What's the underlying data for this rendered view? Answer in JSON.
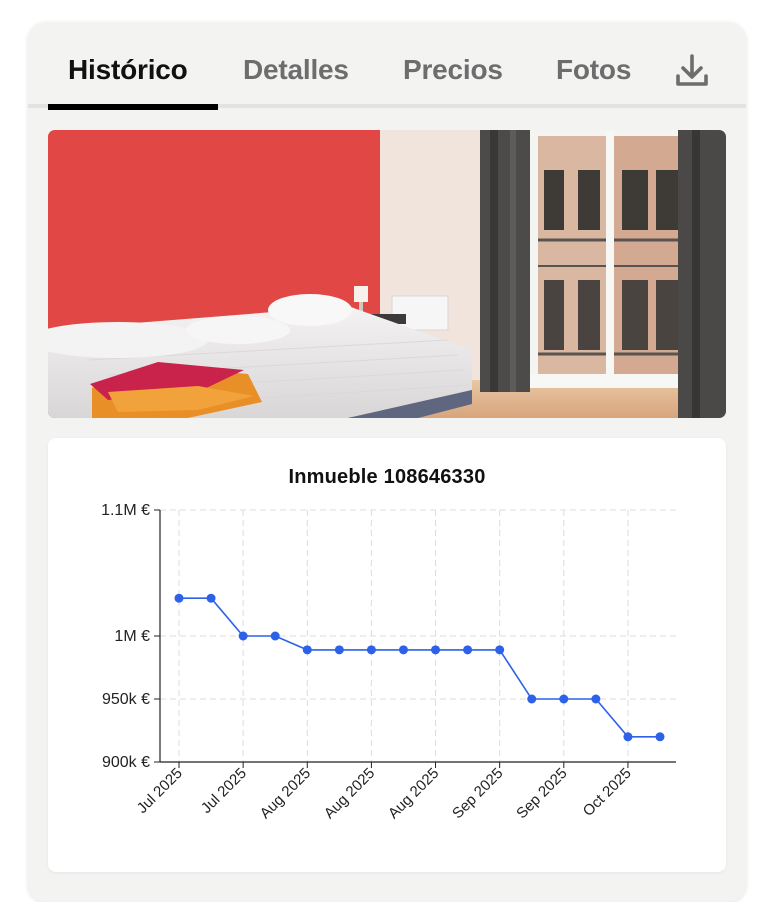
{
  "tabs": [
    {
      "label": "Histórico",
      "active": true
    },
    {
      "label": "Detalles",
      "active": false
    },
    {
      "label": "Precios",
      "active": false
    },
    {
      "label": "Fotos",
      "active": false
    }
  ],
  "download_icon": "download-icon",
  "photo": {
    "icon": "bedroom-photo"
  },
  "colors": {
    "accent": "#2c61e8",
    "tab_underline": "#000000"
  },
  "chart_data": {
    "type": "line",
    "title": "Inmueble 108646330",
    "xlabel": "",
    "ylabel": "",
    "ylim": [
      900000,
      1100000
    ],
    "yticks": [
      {
        "value": 900000,
        "label": "900k €"
      },
      {
        "value": 950000,
        "label": "950k €"
      },
      {
        "value": 1000000,
        "label": "1M €"
      },
      {
        "value": 1100000,
        "label": "1.1M €"
      }
    ],
    "xticks": [
      "Jul 2025",
      "Jul 2025",
      "Aug 2025",
      "Aug 2025",
      "Aug 2025",
      "Sep 2025",
      "Sep 2025",
      "Oct 2025"
    ],
    "grid": true,
    "series": [
      {
        "values": [
          1030000,
          1030000,
          1000000,
          1000000,
          989000,
          989000,
          989000,
          989000,
          989000,
          989000,
          989000,
          950000,
          950000,
          950000,
          920000,
          920000
        ]
      }
    ]
  }
}
